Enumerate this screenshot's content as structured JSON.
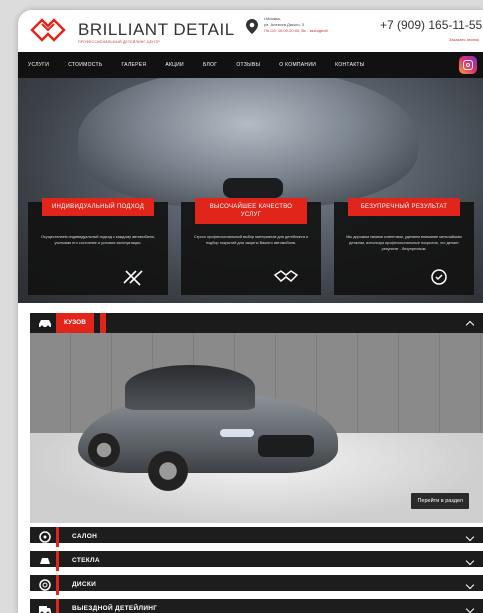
{
  "header": {
    "brand": "BRILLIANT DETAIL",
    "tagline": "ПРОФЕССИОНАЛЬНЫЙ ДЕТЕЙЛИНГ-ЦЕНТР",
    "address_line1": "г.Москва,",
    "address_line2": "ул. Алексея Дикого, 3",
    "hours": "Пн-Сб: 10:00-20:00, Вс - выходной",
    "phone": "+7 (909) 165-11-55",
    "callback": "Заказать звонок"
  },
  "nav": {
    "items": [
      "УСЛУГИ",
      "СТОИМОСТЬ",
      "ГАЛЕРЕЯ",
      "АКЦИИ",
      "БЛОГ",
      "ОТЗЫВЫ",
      "О КОМПАНИИ",
      "КОНТАКТЫ"
    ]
  },
  "features": [
    {
      "title": "ИНДИВИДУАЛЬНЫЙ ПОДХОД",
      "text": "Осуществляем индивидуальный подход к каждому автомобилю, учитывая его состояние и условия эксплуатации."
    },
    {
      "title": "ВЫСОЧАЙШЕЕ КАЧЕСТВО УСЛУГ",
      "text": "Строго профессиональный выбор материалов для детейлинга и подбор покрытий для защиты Вашего автомобиля."
    },
    {
      "title": "БЕЗУПРЕЧНЫЙ РЕЗУЛЬТАТ",
      "text": "Мы дорожим своими клиентами, уделяем внимание мельчайшим деталям, используя профессиональные покрытия, что делает результат - безупречным."
    }
  ],
  "sections": {
    "open": {
      "label": "КУЗОВ",
      "button": "Перейти в раздел"
    },
    "closed": [
      "САЛОН",
      "СТЕКЛА",
      "ДИСКИ",
      "ВЫЕЗДНОЙ ДЕТЕЙЛИНГ"
    ]
  },
  "colors": {
    "accent": "#e1251b",
    "dark": "#1b1b1b"
  }
}
